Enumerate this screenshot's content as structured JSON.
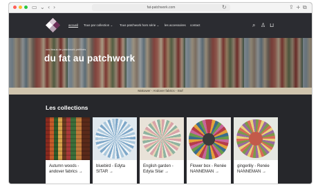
{
  "browser": {
    "url": "fat-patchwork.com",
    "colors": {
      "close": "#ff5f57",
      "minimize": "#febc2e",
      "maximize": "#28c840"
    }
  },
  "nav": {
    "items": [
      {
        "label": "accueil",
        "active": true
      },
      {
        "label": "Tous par collection ⌄"
      },
      {
        "label": "Tous patchwork hors série ⌄"
      },
      {
        "label": "les accessoires"
      },
      {
        "label": "contact"
      }
    ],
    "icons": [
      "search-icon",
      "account-icon",
      "cart-icon"
    ]
  },
  "hero": {
    "kicker": "vos tissus de patchwork préférés",
    "title": "du fat au patchwork"
  },
  "strip": {
    "text": "Makower - Andover fabrics - Stof"
  },
  "collections": {
    "title": "Les collections",
    "cards": [
      {
        "caption": "Autumn woods - andover fabrics →"
      },
      {
        "caption": "bluebird - Edyta SITAR →"
      },
      {
        "caption": "English garden - Edyta Sitar →"
      },
      {
        "caption": "Flower box - Renée NANNEMAN →"
      },
      {
        "caption": "gingerlily - Renée NANNEMAN →"
      }
    ]
  }
}
